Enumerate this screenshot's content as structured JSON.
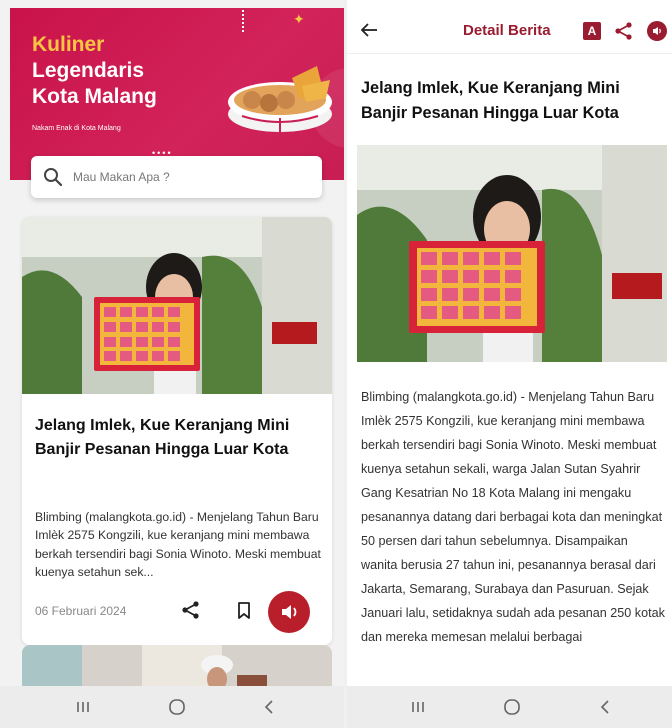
{
  "left": {
    "banner": {
      "title_line1": "Kuliner",
      "title_line2": "Legendaris",
      "title_line3": "Kota Malang",
      "subtitle": "Nakam Enak di Kota Malang",
      "accent_color": "#f5c742",
      "bg_color": "#c9124a"
    },
    "search": {
      "placeholder": "Mau Makan Apa ?"
    },
    "article": {
      "headline": "Jelang Imlek, Kue Keranjang Mini Banjir Pesanan Hingga Luar Kota",
      "excerpt": "Blimbing (malangkota.go.id) - Menjelang Tahun Baru Imlèk 2575 Kongzili, kue keranjang mini membawa berkah tersendiri bagi Sonia Winoto. Meski membuat kuenya setahun sek...",
      "date": "06 Februari 2024",
      "icons": [
        "share-icon",
        "bookmark-icon",
        "speaker-icon"
      ]
    }
  },
  "right": {
    "header": {
      "title": "Detail Berita",
      "font_size_badge": "A",
      "icons": [
        "back-arrow-icon",
        "font-size-icon",
        "share-icon",
        "speaker-icon"
      ],
      "accent_color": "#9a1c30"
    },
    "article": {
      "headline": "Jelang Imlek, Kue Keranjang Mini Banjir Pesanan Hingga Luar Kota",
      "body": "Blimbing (malangkota.go.id) - Menjelang Tahun Baru Imlèk 2575 Kongzili, kue keranjang mini membawa berkah tersendiri bagi Sonia Winoto. Meski membuat kuenya setahun sekali, warga Jalan Sutan Syahrir Gang Kesatrian No 18 Kota Malang ini mengaku pesanannya datang dari berbagai kota dan meningkat 50 persen dari tahun sebelumnya. Disampaikan wanita berusia 27 tahun ini, pesanannya berasal dari Jakarta, Semarang, Surabaya dan Pasuruan. Sejak Januari lalu, setidaknya sudah ada pesanan 250 kotak dan mereka memesan melalui berbagai"
    }
  },
  "navbar": {
    "icons": [
      "recents-icon",
      "home-icon",
      "back-icon"
    ]
  }
}
